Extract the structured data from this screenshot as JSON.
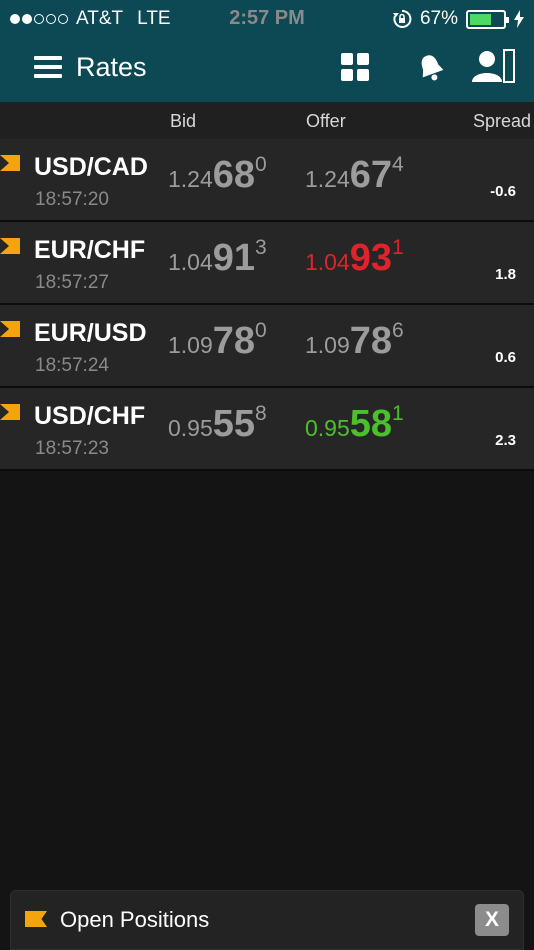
{
  "status_bar": {
    "carrier": "AT&T",
    "network": "LTE",
    "time": "2:57 PM",
    "battery": "67%",
    "battery_level": 0.67,
    "signal_bars_filled": 2,
    "signal_bars_total": 5
  },
  "nav": {
    "title": "Rates",
    "icons": [
      "menu-icon",
      "grid-icon",
      "bell-icon",
      "user-icon"
    ]
  },
  "columns": {
    "bid": "Bid",
    "offer": "Offer",
    "spread": "Spread"
  },
  "rates": [
    {
      "pair": "USD/CAD",
      "time": "18:57:20",
      "bid": {
        "pre": "1.24",
        "big": "68",
        "sup": "0",
        "state": "neutral"
      },
      "offer": {
        "pre": "1.24",
        "big": "67",
        "sup": "4",
        "state": "neutral"
      },
      "spread": "-0.6"
    },
    {
      "pair": "EUR/CHF",
      "time": "18:57:27",
      "bid": {
        "pre": "1.04",
        "big": "91",
        "sup": "3",
        "state": "neutral"
      },
      "offer": {
        "pre": "1.04",
        "big": "93",
        "sup": "1",
        "state": "down"
      },
      "spread": "1.8"
    },
    {
      "pair": "EUR/USD",
      "time": "18:57:24",
      "bid": {
        "pre": "1.09",
        "big": "78",
        "sup": "0",
        "state": "neutral"
      },
      "offer": {
        "pre": "1.09",
        "big": "78",
        "sup": "6",
        "state": "neutral"
      },
      "spread": "0.6"
    },
    {
      "pair": "USD/CHF",
      "time": "18:57:23",
      "bid": {
        "pre": "0.95",
        "big": "55",
        "sup": "8",
        "state": "neutral"
      },
      "offer": {
        "pre": "0.95",
        "big": "58",
        "sup": "1",
        "state": "up"
      },
      "spread": "2.3"
    }
  ],
  "bottom_bar": {
    "label": "Open Positions",
    "close": "X"
  },
  "colors": {
    "header_bg": "#0c4954",
    "row_bg": "#262626",
    "flag": "#f4a40c",
    "down": "#e0232b",
    "up": "#4ac12a",
    "neutral_price": "#9c9c9c"
  }
}
